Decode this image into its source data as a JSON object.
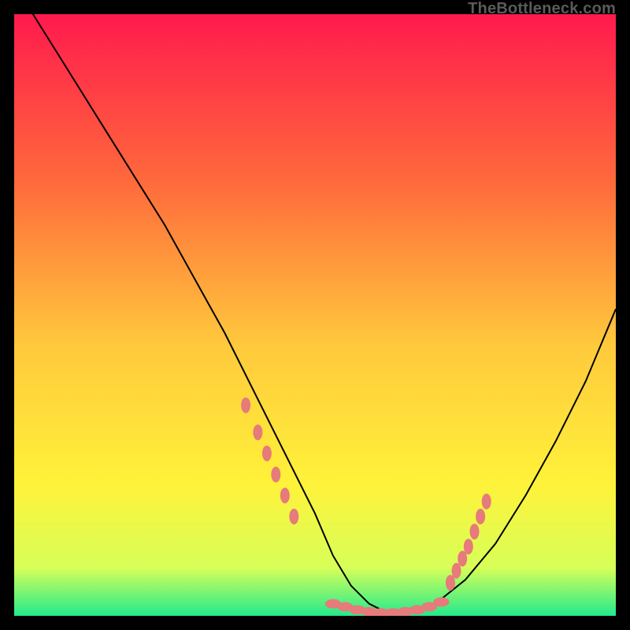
{
  "watermark": "TheBottleneck.com",
  "colors": {
    "bg_black": "#000000",
    "gradient_top": "#ff1a4d",
    "gradient_mid1": "#ff6a3c",
    "gradient_mid2": "#ffc93c",
    "gradient_mid3": "#fff23a",
    "gradient_mid4": "#d7ff58",
    "gradient_bottom": "#23ea8d",
    "curve": "#000000",
    "marker": "#e77a7a"
  },
  "chart_data": {
    "type": "line",
    "title": "",
    "xlabel": "",
    "ylabel": "",
    "xlim": [
      0,
      100
    ],
    "ylim": [
      0,
      100
    ],
    "series": [
      {
        "name": "bottleneck-curve",
        "x": [
          0,
          5,
          10,
          15,
          20,
          25,
          30,
          35,
          40,
          45,
          50,
          53,
          56,
          59,
          62,
          66,
          70,
          75,
          80,
          85,
          90,
          95,
          100
        ],
        "values": [
          105,
          97,
          89,
          81,
          73,
          65,
          56,
          47,
          37,
          27,
          17,
          10,
          5,
          2,
          0.5,
          0.5,
          2,
          6,
          12,
          20,
          29,
          39,
          51
        ]
      }
    ],
    "markers": {
      "name": "highlight-dots",
      "x_left": [
        38.5,
        40.5,
        42.0,
        43.5,
        45.0,
        46.5
      ],
      "y_left": [
        35.0,
        30.5,
        27.0,
        23.5,
        20.0,
        16.5
      ],
      "x_mid": [
        53.0,
        55.0,
        57.0,
        59.0,
        61.0,
        63.0,
        65.0,
        67.0,
        69.0,
        71.0
      ],
      "y_mid": [
        2.0,
        1.5,
        1.0,
        0.7,
        0.5,
        0.5,
        0.7,
        1.0,
        1.5,
        2.3
      ],
      "x_right": [
        72.5,
        73.5,
        74.5,
        75.5,
        76.5,
        77.5,
        78.5
      ],
      "y_right": [
        5.5,
        7.5,
        9.5,
        11.5,
        14.0,
        16.5,
        19.0
      ]
    }
  }
}
